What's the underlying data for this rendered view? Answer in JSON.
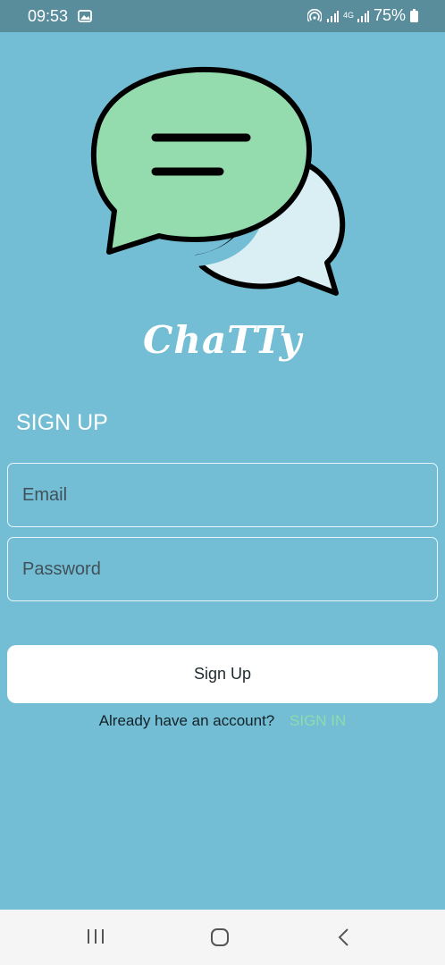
{
  "status": {
    "time": "09:53",
    "battery": "75%",
    "network": "4G"
  },
  "app": {
    "name": "ChaTTy"
  },
  "form": {
    "title": "SIGN UP",
    "email_placeholder": "Email",
    "password_placeholder": "Password",
    "submit_label": "Sign Up",
    "footer_text": "Already have an account?",
    "footer_link": "SIGN IN"
  },
  "colors": {
    "background": "#73bed4",
    "bubble_green": "#94dcad",
    "bubble_light": "#d9eff4",
    "link": "#8ddbae"
  },
  "icons": [
    "gallery-icon",
    "hotspot-icon",
    "signal-icon",
    "battery-icon",
    "recents-icon",
    "home-icon",
    "back-icon"
  ]
}
